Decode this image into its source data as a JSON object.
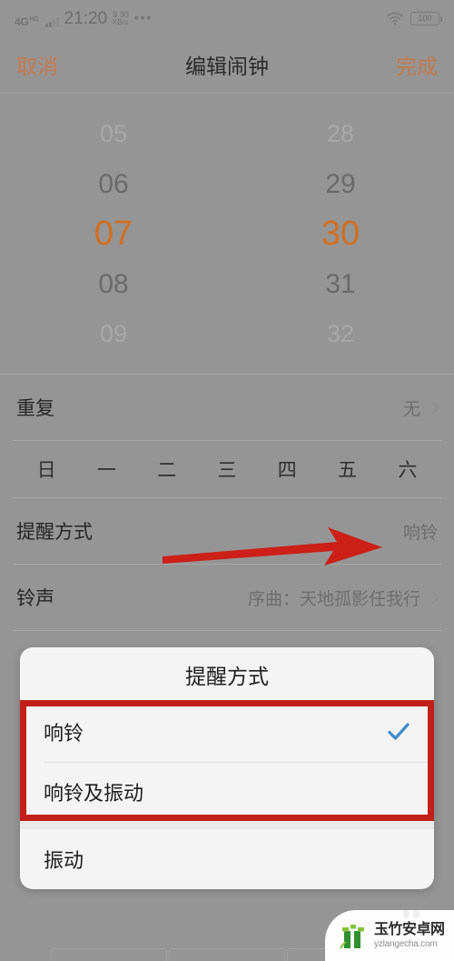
{
  "status_bar": {
    "network_type": "4G",
    "network_badge": "HD",
    "time": "21:20",
    "speed_value": "9.30",
    "speed_unit": "KB/s",
    "overflow_dots": "•••",
    "wifi_icon": "wifi-icon",
    "battery_level": "100"
  },
  "nav_bar": {
    "cancel_label": "取消",
    "title": "编辑闹钟",
    "done_label": "完成",
    "accent_color": "#c27a4e"
  },
  "time_picker": {
    "hours": [
      "05",
      "06",
      "07",
      "08",
      "09"
    ],
    "minutes": [
      "28",
      "29",
      "30",
      "31",
      "32"
    ],
    "selected_hour": "07",
    "selected_minute": "30",
    "selected_color": "#d06f22"
  },
  "settings_rows": [
    {
      "label": "重复",
      "value": "无",
      "has_chevron": true
    },
    {
      "label": "提醒方式",
      "value": "响铃",
      "has_chevron": false
    },
    {
      "label": "铃声",
      "value": "序曲：天地孤影任我行",
      "has_chevron": true
    }
  ],
  "weekdays": [
    "日",
    "一",
    "二",
    "三",
    "四",
    "五",
    "六"
  ],
  "dialog": {
    "title": "提醒方式",
    "options": [
      {
        "label": "响铃",
        "selected": true
      },
      {
        "label": "响铃及振动",
        "selected": false
      },
      {
        "label": "振动",
        "selected": false
      }
    ],
    "check_color": "#3d8dcc",
    "background": "#f4f4f4"
  },
  "annotations": {
    "arrow_color": "#cc2018",
    "box_color": "#c1201a",
    "arrow_name": "red-pointer-arrow",
    "box_name": "red-highlight-box"
  },
  "watermark": {
    "site_name_cn": "玉竹安卓网",
    "site_url": "yzlangecha.com",
    "logo_color": "#4ca02c"
  }
}
